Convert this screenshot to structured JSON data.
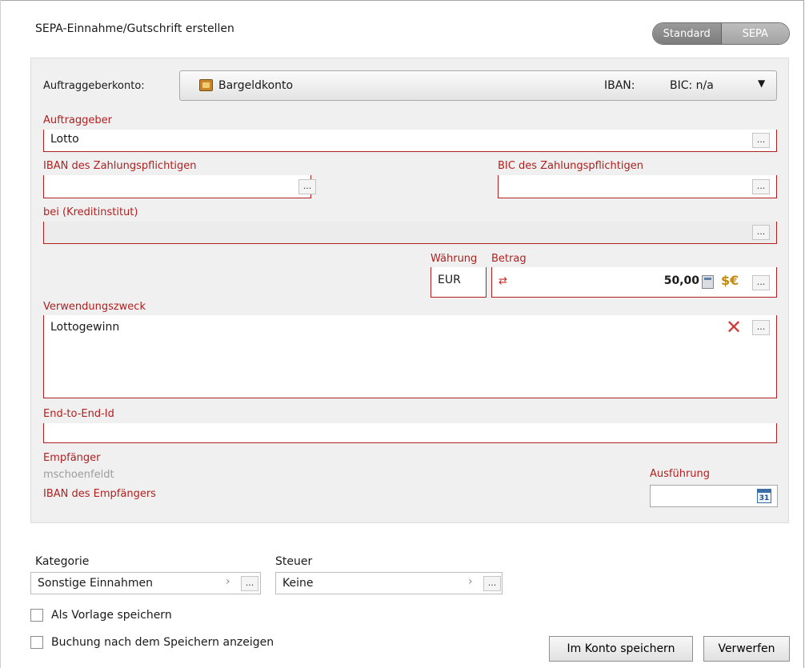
{
  "dialog": {
    "title": "SEPA-Einnahme/Gutschrift erstellen",
    "mode_toggle": {
      "options": [
        "Standard",
        "SEPA"
      ],
      "selected": "SEPA"
    }
  },
  "form": {
    "account_label": "Auftraggeberkonto:",
    "account_name": "Bargeldkonto",
    "account_iban_label": "IBAN:",
    "account_bic_label": "BIC: n/a",
    "originator_label": "Auftraggeber",
    "originator_value": "Lotto",
    "payer_iban_label": "IBAN des Zahlungspflichtigen",
    "payer_iban_value": "",
    "payer_bic_label": "BIC des Zahlungspflichtigen",
    "payer_bic_value": "",
    "bank_label": "bei (Kreditinstitut)",
    "bank_value": "",
    "currency_label": "Währung",
    "currency_value": "EUR",
    "amount_label": "Betrag",
    "amount_value": "50,00",
    "purpose_label": "Verwendungszweck",
    "purpose_value": "Lottogewinn",
    "e2e_label": "End-to-End-Id",
    "e2e_value": "",
    "recipient_label": "Empfänger",
    "recipient_name": "mschoenfeldt",
    "recipient_iban_label": "IBAN des Empfängers",
    "execution_label": "Ausführung",
    "execution_value": "",
    "dots_label": "..."
  },
  "bottom": {
    "category_label": "Kategorie",
    "category_value": "Sonstige Einnahmen",
    "tax_label": "Steuer",
    "tax_value": "Keine",
    "save_template_label": "Als Vorlage speichern",
    "save_template_checked": false,
    "show_after_save_label": "Buchung nach dem Speichern anzeigen",
    "show_after_save_checked": false,
    "save_button": "Im Konto speichern",
    "discard_button": "Verwerfen"
  },
  "icons": {
    "account": "folder-icon",
    "amount_swap": "swap-arrows-icon",
    "calculator": "calculator-icon",
    "currency_convert": "currency-convert-icon",
    "clear": "x-delete-icon",
    "calendar": "calendar-icon",
    "chevron": "chevron-right-icon",
    "dropdown": "caret-down-icon"
  },
  "colors": {
    "required_label": "#b21f1f",
    "panel_bg": "#f0f0f0",
    "placeholder_gray": "#9c9c9c"
  }
}
